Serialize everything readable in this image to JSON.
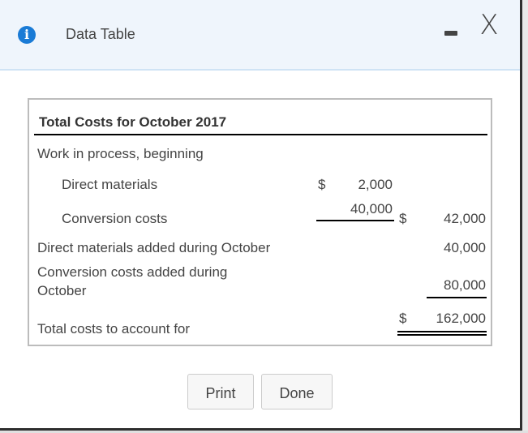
{
  "window": {
    "title": "Data Table",
    "icon": "info-icon",
    "icon_glyph": "i",
    "minimize_icon": "minimize-icon",
    "close_icon": "close-icon",
    "close_glyph": "X"
  },
  "table": {
    "heading": "Total Costs for October 2017",
    "rows": [
      {
        "label": "Work in process, beginning"
      },
      {
        "label": "Direct materials",
        "currency1": "$",
        "col1": "2,000"
      },
      {
        "label": "Conversion costs",
        "col1": "40,000",
        "currency2": "$",
        "col2": "42,000"
      },
      {
        "label": "Direct materials added during October",
        "col2": "40,000"
      },
      {
        "label_line1": "Conversion costs added during",
        "label_line2": "October",
        "col2": "80,000"
      },
      {
        "label": "Total costs to account for",
        "currency2": "$",
        "col2": "162,000"
      }
    ]
  },
  "buttons": {
    "print": "Print",
    "done": "Done"
  },
  "colors": {
    "accent": "#1a7bd6",
    "header_bg": "#eff5fc"
  }
}
